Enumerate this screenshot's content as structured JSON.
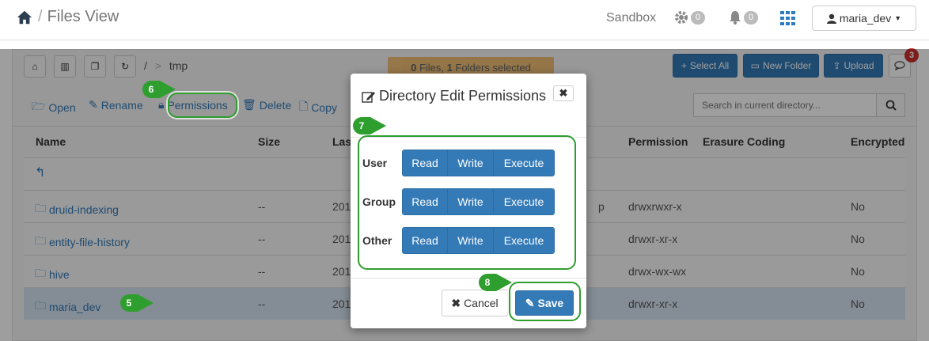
{
  "header": {
    "title": "Files View",
    "sandbox": "Sandbox",
    "settings_count": "0",
    "alerts_count": "0",
    "user": "maria_dev"
  },
  "toolbar": {
    "path_root": "/",
    "path_sep": ">",
    "path_current": "tmp",
    "selection_count_files": "0",
    "selection_files_label": "Files,",
    "selection_count_folders": "1",
    "selection_folders_label": "Folders selected",
    "select_all": "Select All",
    "new_folder": "New Folder",
    "upload": "Upload",
    "notification_count": "3"
  },
  "actions": {
    "open": "Open",
    "rename": "Rename",
    "permissions": "Permissions",
    "delete": "Delete",
    "copy": "Copy",
    "search_placeholder": "Search in current directory..."
  },
  "table": {
    "columns": {
      "name": "Name",
      "size": "Size",
      "last_modified": "Las",
      "permission": "Permission",
      "erasure_coding": "Erasure Coding",
      "encrypted": "Encrypted"
    },
    "rows": [
      {
        "name": "druid-indexing",
        "size": "--",
        "date": "201",
        "owner_tail": "p",
        "permission": "drwxrwxr-x",
        "encrypted": "No"
      },
      {
        "name": "entity-file-history",
        "size": "--",
        "date": "201",
        "owner_tail": "",
        "permission": "drwxr-xr-x",
        "encrypted": "No"
      },
      {
        "name": "hive",
        "size": "--",
        "date": "201",
        "owner_tail": "",
        "permission": "drwx-wx-wx",
        "encrypted": "No"
      },
      {
        "name": "maria_dev",
        "size": "--",
        "date": "201",
        "owner_tail": "",
        "permission": "drwxr-xr-x",
        "encrypted": "No"
      }
    ]
  },
  "modal": {
    "title": "Directory Edit Permissions",
    "close": "✖",
    "rows": [
      {
        "label": "User",
        "read": "Read",
        "write": "Write",
        "execute": "Execute"
      },
      {
        "label": "Group",
        "read": "Read",
        "write": "Write",
        "execute": "Execute"
      },
      {
        "label": "Other",
        "read": "Read",
        "write": "Write",
        "execute": "Execute"
      }
    ],
    "cancel": "Cancel",
    "save": "Save"
  },
  "annotations": {
    "step5": "5",
    "step6": "6",
    "step7": "7",
    "step8": "8",
    "marker_color": "#2e9e2e"
  }
}
